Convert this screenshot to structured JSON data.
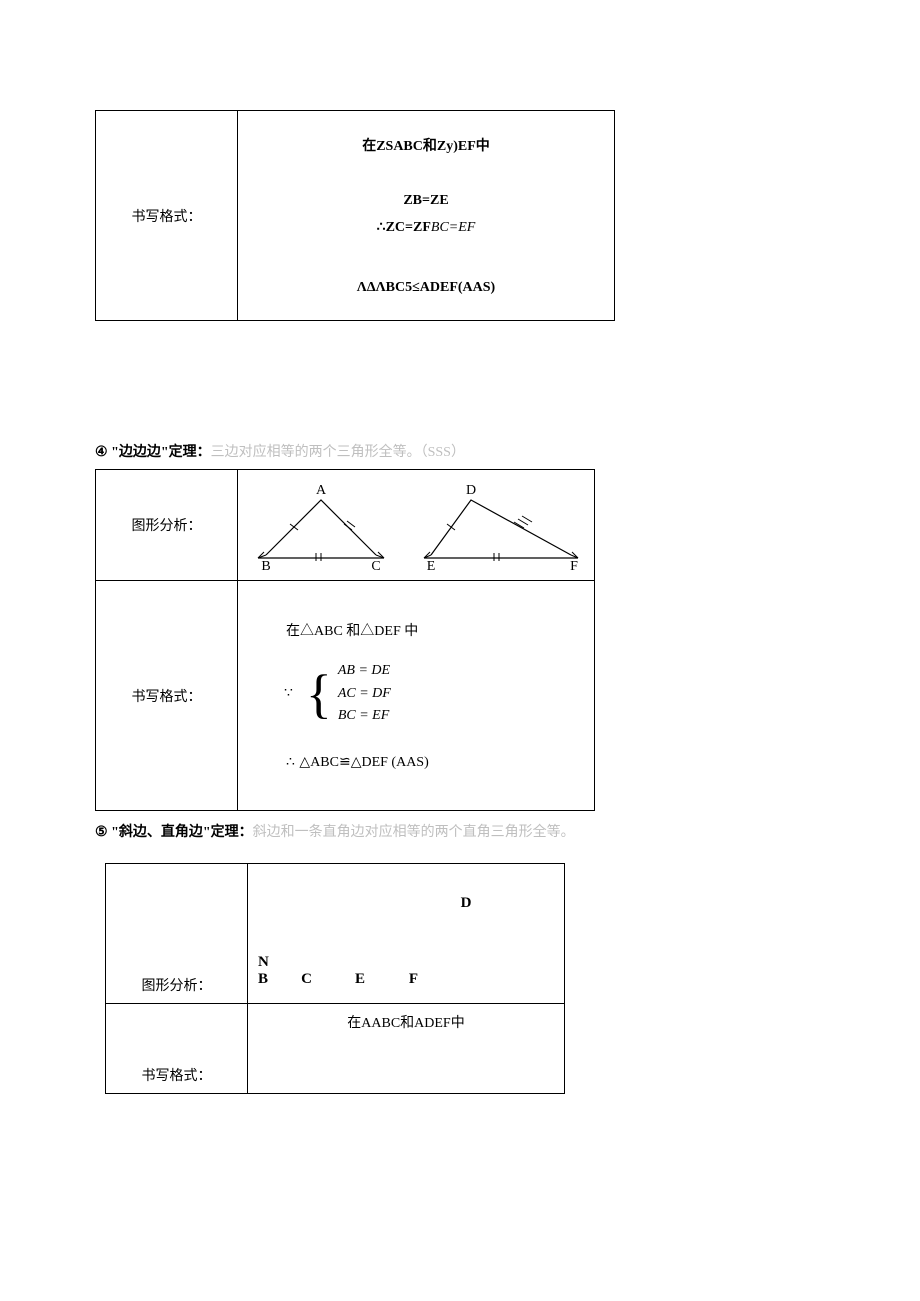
{
  "table1": {
    "label": "书写格式：",
    "line1": "在ZSABC和Zy)EF中",
    "eq1": "ZB=ZE",
    "eq2_prefix": "∴ZC=ZF",
    "eq2_italic": "BC=EF",
    "concl": "ΛΔΛBC5≤ADEF(AAS)"
  },
  "section4": {
    "num": "④",
    "title": "\"边边边\"定理：",
    "rest": "三边对应相等的两个三角形全等。（SSS）"
  },
  "table2": {
    "row1_label": "图形分析：",
    "tri1": {
      "A": "A",
      "B": "B",
      "C": "C"
    },
    "tri2": {
      "A": "D",
      "B": "E",
      "C": "F"
    },
    "row2_label": "书写格式：",
    "line1": "在△ABC 和△DEF 中",
    "because": "∵",
    "eq1": "AB = DE",
    "eq2": "AC = DF",
    "eq3": "BC = EF",
    "therefore": "∴",
    "concl": "△ABC≌△DEF (AAS)"
  },
  "section5": {
    "num": "⑤",
    "title": "\"斜边、直角边\"定理：",
    "rest": "斜边和一条直角边对应相等的两个直角三角形全等。"
  },
  "table3": {
    "D": "D",
    "N": "N",
    "B": "B",
    "C": "C",
    "E": "E",
    "F": "F",
    "row1_label": "图形分析：",
    "row2_label": "书写格式：",
    "line1": "在AABC和ADEF中"
  }
}
